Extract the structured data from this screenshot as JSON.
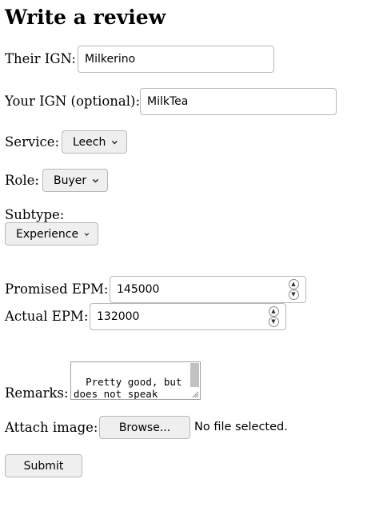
{
  "page": {
    "title": "Write a review"
  },
  "form": {
    "their_ign": {
      "label": "Their IGN:",
      "value": "Milkerino"
    },
    "your_ign": {
      "label": "Your IGN (optional):",
      "value": "MilkTea"
    },
    "service": {
      "label": "Service:",
      "selected": "Leech"
    },
    "role": {
      "label": "Role:",
      "selected": "Buyer"
    },
    "subtype": {
      "label": "Subtype:",
      "selected": "Experience"
    },
    "promised_epm": {
      "label": "Promised EPM:",
      "value": "145000"
    },
    "actual_epm": {
      "label": "Actual EPM:",
      "value": "132000"
    },
    "remarks": {
      "label": "Remarks:",
      "value": "Pretty good, but does not speak English fluently"
    },
    "attach_image": {
      "label": "Attach image:",
      "button": "Browse...",
      "status": "No file selected."
    },
    "submit": {
      "label": "Submit"
    }
  }
}
